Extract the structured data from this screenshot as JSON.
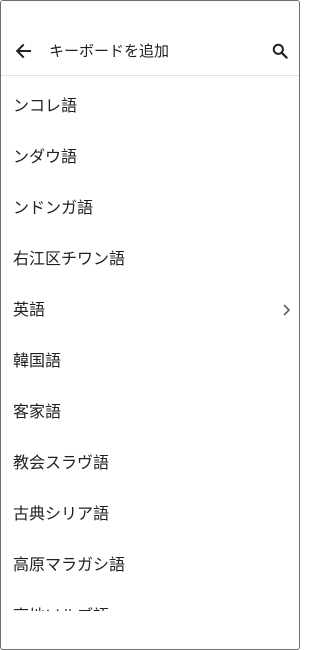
{
  "header": {
    "title": "キーボードを追加",
    "back_icon": "arrow-back-icon",
    "search_icon": "search-icon"
  },
  "languages": [
    {
      "label": "ンコレ語",
      "has_submenu": false
    },
    {
      "label": "ンダウ語",
      "has_submenu": false
    },
    {
      "label": "ンドンガ語",
      "has_submenu": false
    },
    {
      "label": "右江区チワン語",
      "has_submenu": false
    },
    {
      "label": "英語",
      "has_submenu": true
    },
    {
      "label": "韓国語",
      "has_submenu": false
    },
    {
      "label": "客家語",
      "has_submenu": false
    },
    {
      "label": "教会スラヴ語",
      "has_submenu": false
    },
    {
      "label": "古典シリア語",
      "has_submenu": false
    },
    {
      "label": "高原マラガシ語",
      "has_submenu": false
    },
    {
      "label": "高地ソルブ語",
      "has_submenu": false
    }
  ],
  "colors": {
    "text": "#202124",
    "icon": "#202124",
    "chevron": "#5f6368",
    "divider": "#e2e2e2"
  }
}
